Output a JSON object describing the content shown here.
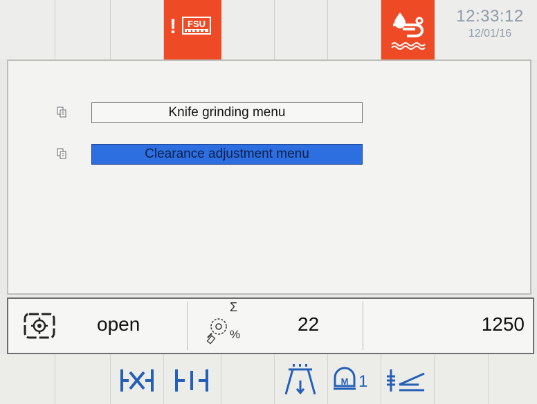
{
  "header": {
    "alert_icon": "fsu-alert-icon",
    "alert_label": "FSU",
    "coolant_icon": "coolant-alarm-icon",
    "time": "12:33:12",
    "date": "12/01/16",
    "alarm_color": "#ee4a26"
  },
  "menu": {
    "items": [
      {
        "label": "Knife grinding menu",
        "selected": false
      },
      {
        "label": "Clearance adjustment menu",
        "selected": true
      }
    ],
    "selected_color": "#2d6fe0"
  },
  "status_bar": {
    "knife_state_icon": "knife-state-icon",
    "knife_state": "open",
    "counter_icon": "grinding-counter-icon",
    "sigma_label": "Σ",
    "percent_label": "%",
    "count": "22",
    "total": "1250"
  },
  "bottom_toolbar": {
    "m1_label": "1",
    "icons": [
      "clearance-close-icon",
      "clearance-open-icon",
      "crane-arrow-icon",
      "motor-m1-icon",
      "knife-adjust-icon"
    ],
    "icon_color": "#2460b8"
  }
}
